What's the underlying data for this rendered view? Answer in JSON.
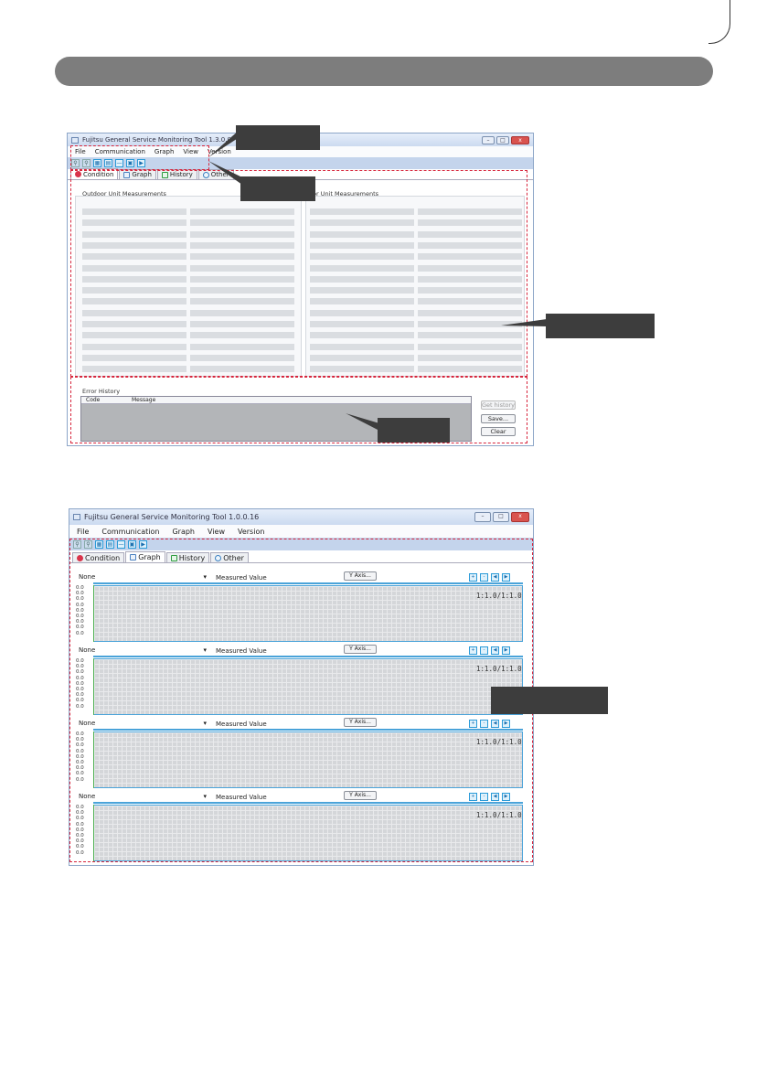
{
  "screen1": {
    "window_title": "Fujitsu General Service Monitoring Tool 1.3.0.0",
    "menu": [
      "File",
      "Communication",
      "Graph",
      "View",
      "Version"
    ],
    "tabs": [
      {
        "label": "Condition",
        "icon": "condition-icon"
      },
      {
        "label": "Graph",
        "icon": "graph-icon"
      },
      {
        "label": "History",
        "icon": "history-icon"
      },
      {
        "label": "Other",
        "icon": "other-icon"
      }
    ],
    "outdoor_title": "Outdoor Unit Measurements",
    "indoor_title": "or Unit Measurements",
    "error_history_title": "Error History",
    "columns": {
      "code": "Code",
      "message": "Message"
    },
    "buttons": {
      "get_history": "Get history",
      "save": "Save...",
      "clear": "Clear"
    }
  },
  "screen2": {
    "window_title": "Fujitsu General Service Monitoring Tool 1.0.0.16",
    "menu": [
      "File",
      "Communication",
      "Graph",
      "View",
      "Version"
    ],
    "tabs": [
      {
        "label": "Condition",
        "icon": "condition-icon"
      },
      {
        "label": "Graph",
        "icon": "graph-icon"
      },
      {
        "label": "History",
        "icon": "history-icon"
      },
      {
        "label": "Other",
        "icon": "other-icon"
      }
    ],
    "graphs": [
      {
        "select": "None",
        "measured": "Measured Value",
        "yaxis": "Y Axis...",
        "ratio": "1:1.0/1:1.0",
        "ticks": [
          "0.0",
          "0.0",
          "0.0",
          "0.0",
          "0.0",
          "0.0",
          "0.0",
          "0.0",
          "0.0"
        ]
      },
      {
        "select": "None",
        "measured": "Measured Value",
        "yaxis": "Y Axis...",
        "ratio": "1:1.0/1:1.0",
        "ticks": [
          "0.0",
          "0.0",
          "0.0",
          "0.0",
          "0.0",
          "0.0",
          "0.0",
          "0.0",
          "0.0"
        ]
      },
      {
        "select": "None",
        "measured": "Measured Value",
        "yaxis": "Y Axis...",
        "ratio": "1:1.0/1:1.0",
        "ticks": [
          "0.0",
          "0.0",
          "0.0",
          "0.0",
          "0.0",
          "0.0",
          "0.0",
          "0.0",
          "0.0"
        ]
      },
      {
        "select": "None",
        "measured": "Measured Value",
        "yaxis": "Y Axis...",
        "ratio": "1:1.0/1:1.0",
        "ticks": [
          "0.0",
          "0.0",
          "0.0",
          "0.0",
          "0.0",
          "0.0",
          "0.0",
          "0.0",
          "0.0"
        ]
      }
    ]
  },
  "colors": {
    "highlight_dash": "#d7263d",
    "callout": "#3d3d3d",
    "header_bar": "#7d7d7d"
  }
}
